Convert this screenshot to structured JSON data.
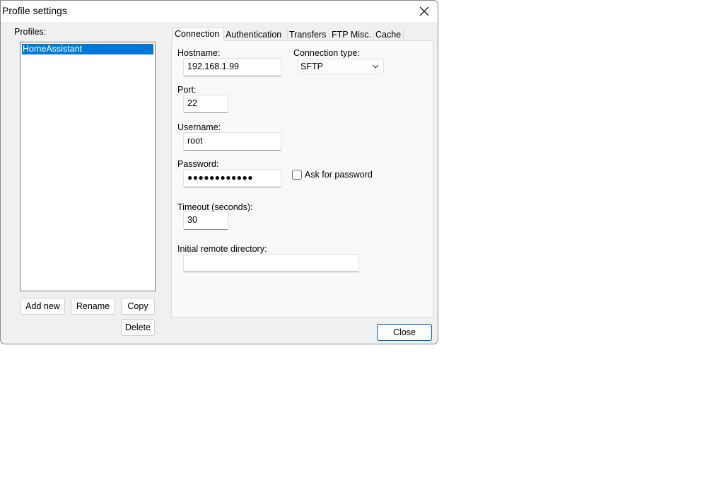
{
  "window": {
    "title": "Profile settings",
    "close_glyph": "✕"
  },
  "profiles": {
    "label": "Profiles:",
    "items": [
      "HomeAssistant"
    ],
    "buttons": {
      "add_new": "Add new",
      "rename": "Rename",
      "copy": "Copy",
      "delete": "Delete"
    }
  },
  "tabs": [
    "Connection",
    "Authentication",
    "Transfers",
    "FTP Misc.",
    "Cache"
  ],
  "active_tab": "Connection",
  "connection": {
    "hostname_label": "Hostname:",
    "hostname_value": "192.168.1.99",
    "connection_type_label": "Connection type:",
    "connection_type_value": "SFTP",
    "port_label": "Port:",
    "port_value": "22",
    "username_label": "Username:",
    "username_value": "root",
    "password_label": "Password:",
    "password_masked": "●●●●●●●●●●●●",
    "ask_for_password_label": "Ask for password",
    "ask_for_password_checked": false,
    "timeout_label": "Timeout (seconds):",
    "timeout_value": "30",
    "initial_dir_label": "Initial remote directory:",
    "initial_dir_value": ""
  },
  "footer": {
    "close_label": "Close"
  },
  "colors": {
    "selection": "#0078d7",
    "default_button_border": "#0067c0",
    "dialog_bg": "#f0f0f0"
  }
}
